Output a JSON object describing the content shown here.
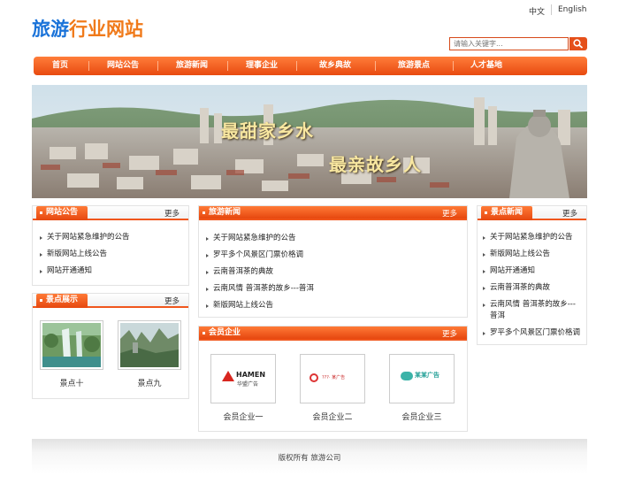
{
  "header": {
    "logo_part1": "旅游",
    "logo_part2": "行业网站",
    "lang_cn": "中文",
    "lang_en": "English",
    "search_placeholder": "请输入关键字...",
    "search_icon": "magnifier-icon"
  },
  "nav": [
    "首页",
    "网站公告",
    "旅游新闻",
    "理事企业",
    "故乡典故",
    "旅游景点",
    "人才基地"
  ],
  "banner": {
    "slogan1": "最甜家乡水",
    "slogan2": "最亲故乡人"
  },
  "announcements": {
    "title": "网站公告",
    "more": "更多",
    "items": [
      "关于网站紧急维护的公告",
      "新版网站上线公告",
      "网站开通通知"
    ]
  },
  "scenic_show": {
    "title": "景点展示",
    "more": "更多",
    "items": [
      "景点十",
      "景点九"
    ]
  },
  "travel_news": {
    "title": "旅游新闻",
    "more": "更多",
    "items": [
      "关于网站紧急维护的公告",
      "罗平多个风景区门票价格调",
      "云南普洱茶的典故",
      "云南风情 普洱茶的故乡---普洱",
      "新版网站上线公告"
    ]
  },
  "members": {
    "title": "会员企业",
    "more": "更多",
    "items": [
      {
        "name": "会员企业一",
        "logo_text": "HAMEN",
        "logo_sub": "华盟广告"
      },
      {
        "name": "会员企业二",
        "logo_text": "???· 某广告",
        "logo_sub": ""
      },
      {
        "name": "会员企业三",
        "logo_text": "某某广告",
        "logo_sub": ""
      }
    ]
  },
  "scenic_news": {
    "title": "景点新闻",
    "more": "更多",
    "items": [
      "关于网站紧急维护的公告",
      "新版网站上线公告",
      "网站开通通知",
      "云南普洱茶的典故",
      "云南风情 普洱茶的故乡---",
      "普洱",
      "罗平多个风景区门票价格调"
    ]
  },
  "footer": {
    "copyright": "版权所有 旅游公司"
  },
  "colors": {
    "accent": "#e84a10",
    "logo_blue": "#1a73d9",
    "logo_orange": "#f07a1a"
  }
}
